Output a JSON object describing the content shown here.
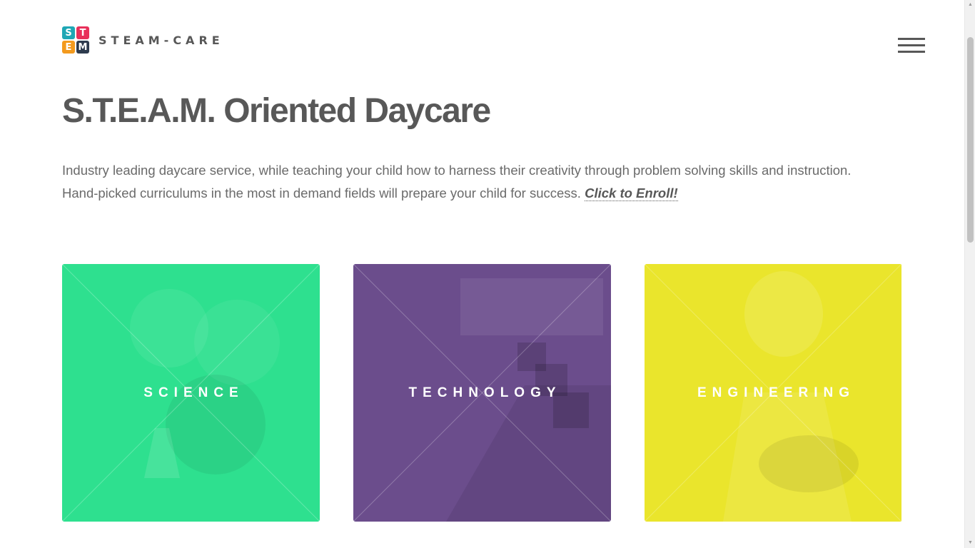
{
  "brand": {
    "name": "STEAM-CARE",
    "logo_letters": [
      {
        "letter": "S",
        "color": "#1fa7b5"
      },
      {
        "letter": "T",
        "color": "#e8305a"
      },
      {
        "letter": "E",
        "color": "#f39a1e"
      },
      {
        "letter": "M",
        "color": "#2e3b4e"
      }
    ]
  },
  "nav": {
    "menu_icon": "hamburger-menu-icon"
  },
  "hero": {
    "title": "S.T.E.A.M. Oriented Daycare",
    "description": "Industry leading daycare service, while teaching your child how to harness their creativity through problem solving skills and instruction. Hand-picked curriculums in the most in demand fields will prepare your child for success. ",
    "cta_label": "Click to Enroll!"
  },
  "tiles": [
    {
      "label": "SCIENCE",
      "color": "#2ee08f"
    },
    {
      "label": "TECHNOLOGY",
      "color": "#6b4d8c"
    },
    {
      "label": "ENGINEERING",
      "color": "#eae52c"
    }
  ]
}
